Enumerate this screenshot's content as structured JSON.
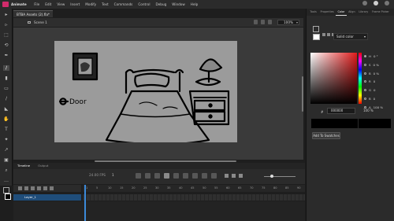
{
  "app": {
    "title": "Animate"
  },
  "menu": [
    "File",
    "Edit",
    "View",
    "Insert",
    "Modify",
    "Text",
    "Commands",
    "Control",
    "Debug",
    "Window",
    "Help"
  ],
  "document": {
    "tab_label": "BTBA Assets (2).fla*"
  },
  "scene": {
    "name": "Scene 1",
    "zoom": "100%"
  },
  "stage_art": {
    "door_label": "Door"
  },
  "right_panel": {
    "tabs": [
      "Tools",
      "Properties",
      "Color",
      "Align",
      "Library",
      "Frame Picker"
    ],
    "active_tab": "Color",
    "color_type": "Solid color",
    "hsb": [
      {
        "key": "H",
        "value": "0 °",
        "selected": true
      },
      {
        "key": "S",
        "value": "0 %",
        "selected": false
      },
      {
        "key": "B",
        "value": "0 %",
        "selected": false
      },
      {
        "key": "R",
        "value": "0",
        "selected": false
      },
      {
        "key": "G",
        "value": "0",
        "selected": false
      },
      {
        "key": "B",
        "value": "0",
        "selected": false
      },
      {
        "key": "A",
        "value": "100 %",
        "selected": false
      }
    ],
    "hex_label": "#",
    "hex_value": "000000",
    "alpha_value": "100 %",
    "add_swatch_label": "Add To Swatches",
    "colors": {
      "fill": "#ffffff",
      "preview": "#000000"
    }
  },
  "timeline": {
    "tabs": [
      "Timeline",
      "Output"
    ],
    "fps": "24.00",
    "fps_unit": "FPS",
    "current_frame": "1",
    "ruler": [
      "1",
      "5",
      "10",
      "15",
      "20",
      "25",
      "30",
      "35",
      "40",
      "45",
      "50",
      "55",
      "60",
      "65",
      "70",
      "75",
      "80",
      "85",
      "90"
    ],
    "layer_name": "Layer_1"
  }
}
